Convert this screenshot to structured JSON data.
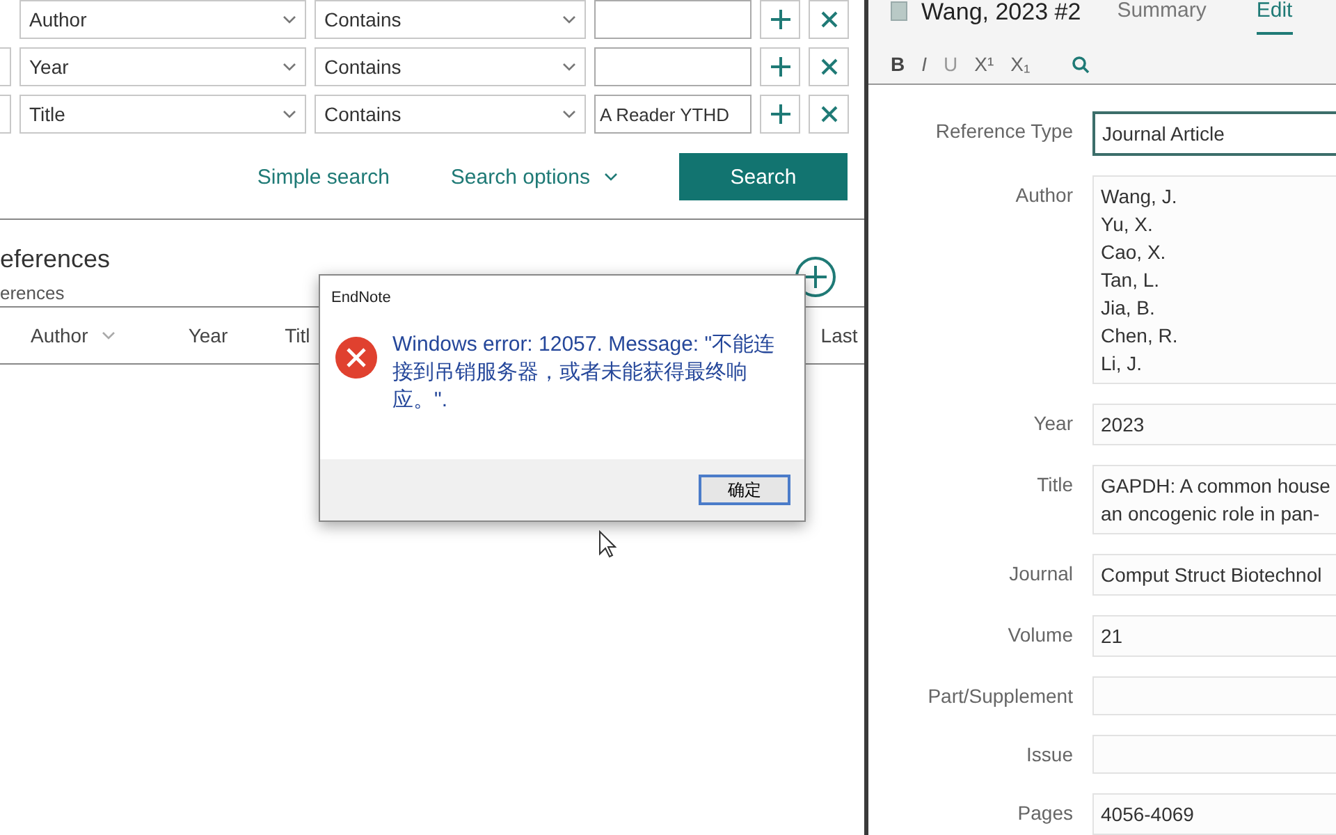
{
  "search_rows": [
    {
      "leading_dropdown": false,
      "field": "Author",
      "operator": "Contains",
      "value": ""
    },
    {
      "leading_dropdown": true,
      "field": "Year",
      "operator": "Contains",
      "value": ""
    },
    {
      "leading_dropdown": true,
      "field": "Title",
      "operator": "Contains",
      "value": "A Reader YTHD"
    }
  ],
  "search_actions": {
    "simple_search": "Simple search",
    "search_options": "Search options",
    "search": "Search"
  },
  "references": {
    "title": "eferences",
    "subtitle": "erences"
  },
  "table": {
    "columns": [
      {
        "label": "Author",
        "menu": true
      },
      {
        "label": "Year",
        "menu": false
      },
      {
        "label": "Titl",
        "menu": false
      },
      {
        "label": "Last",
        "menu": false
      }
    ]
  },
  "dialog": {
    "title": "EndNote",
    "message": "Windows error: 12057. Message: \"不能连接到吊销服务器，或者未能获得最终响应。\".",
    "button": "确定"
  },
  "reference": {
    "title": "Wang, 2023 #2",
    "tabs": [
      {
        "label": "Summary",
        "selected": false
      },
      {
        "label": "Edit",
        "selected": true
      }
    ],
    "format_buttons": [
      {
        "kind": "bold",
        "label": "B"
      },
      {
        "kind": "italic",
        "label": "I"
      },
      {
        "kind": "underline",
        "label": "U"
      },
      {
        "kind": "superscript",
        "label": "X¹"
      },
      {
        "kind": "subscript",
        "label": "X₁"
      }
    ],
    "fields": [
      {
        "label": "Reference Type",
        "lines": [
          "Journal Article"
        ],
        "focused": true
      },
      {
        "label": "Author",
        "lines": [
          "Wang, J.",
          "Yu, X.",
          "Cao, X.",
          "Tan, L.",
          "Jia, B.",
          "Chen, R.",
          "Li, J."
        ],
        "focused": false
      },
      {
        "label": "Year",
        "lines": [
          "2023"
        ],
        "focused": false
      },
      {
        "label": "Title",
        "lines": [
          "GAPDH: A common house",
          "an oncogenic role in pan-"
        ],
        "focused": false
      },
      {
        "label": "Journal",
        "lines": [
          "Comput Struct Biotechnol"
        ],
        "focused": false
      },
      {
        "label": "Volume",
        "lines": [
          "21"
        ],
        "focused": false
      },
      {
        "label": "Part/Supplement",
        "focused": false
      },
      {
        "label": "Issue",
        "focused": false
      },
      {
        "label": "Pages",
        "lines": [
          "4056-4069"
        ],
        "focused": false
      }
    ]
  }
}
